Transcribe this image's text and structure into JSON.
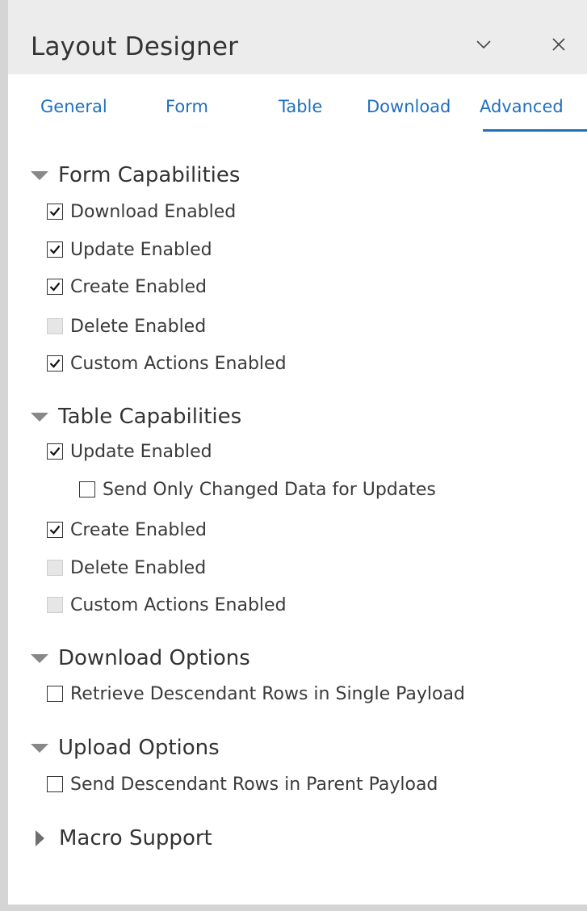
{
  "panel": {
    "title": "Layout Designer",
    "minimize_icon": "chevron-down-icon",
    "close_icon": "close-icon"
  },
  "tabs": [
    {
      "label": "General",
      "active": false
    },
    {
      "label": "Form",
      "active": false
    },
    {
      "label": "Table",
      "active": false
    },
    {
      "label": "Download",
      "active": false
    },
    {
      "label": "Advanced",
      "active": true
    }
  ],
  "colors": {
    "accent": "#1f6fbf",
    "header_bg": "#ececec"
  },
  "sections": {
    "form": {
      "label": "Form Capabilities",
      "expanded": true,
      "options": [
        {
          "label": "Download Enabled",
          "checked": true,
          "disabled": false
        },
        {
          "label": "Update Enabled",
          "checked": true,
          "disabled": false
        },
        {
          "label": "Create Enabled",
          "checked": true,
          "disabled": false
        },
        {
          "label": "Delete Enabled",
          "checked": false,
          "disabled": true
        },
        {
          "label": "Custom Actions Enabled",
          "checked": true,
          "disabled": false
        }
      ]
    },
    "table": {
      "label": "Table Capabilities",
      "expanded": true,
      "options": [
        {
          "label": "Update Enabled",
          "checked": true,
          "disabled": false
        },
        {
          "label": "Send Only Changed Data for Updates",
          "checked": false,
          "disabled": false
        },
        {
          "label": "Create Enabled",
          "checked": true,
          "disabled": false
        },
        {
          "label": "Delete Enabled",
          "checked": false,
          "disabled": true
        },
        {
          "label": "Custom Actions Enabled",
          "checked": false,
          "disabled": true
        }
      ]
    },
    "download": {
      "label": "Download Options",
      "expanded": true,
      "options": [
        {
          "label": "Retrieve Descendant Rows in Single Payload",
          "checked": false,
          "disabled": false
        }
      ]
    },
    "upload": {
      "label": "Upload Options",
      "expanded": true,
      "options": [
        {
          "label": "Send Descendant Rows in Parent Payload",
          "checked": false,
          "disabled": false
        }
      ]
    },
    "macro": {
      "label": "Macro Support",
      "expanded": false
    }
  }
}
